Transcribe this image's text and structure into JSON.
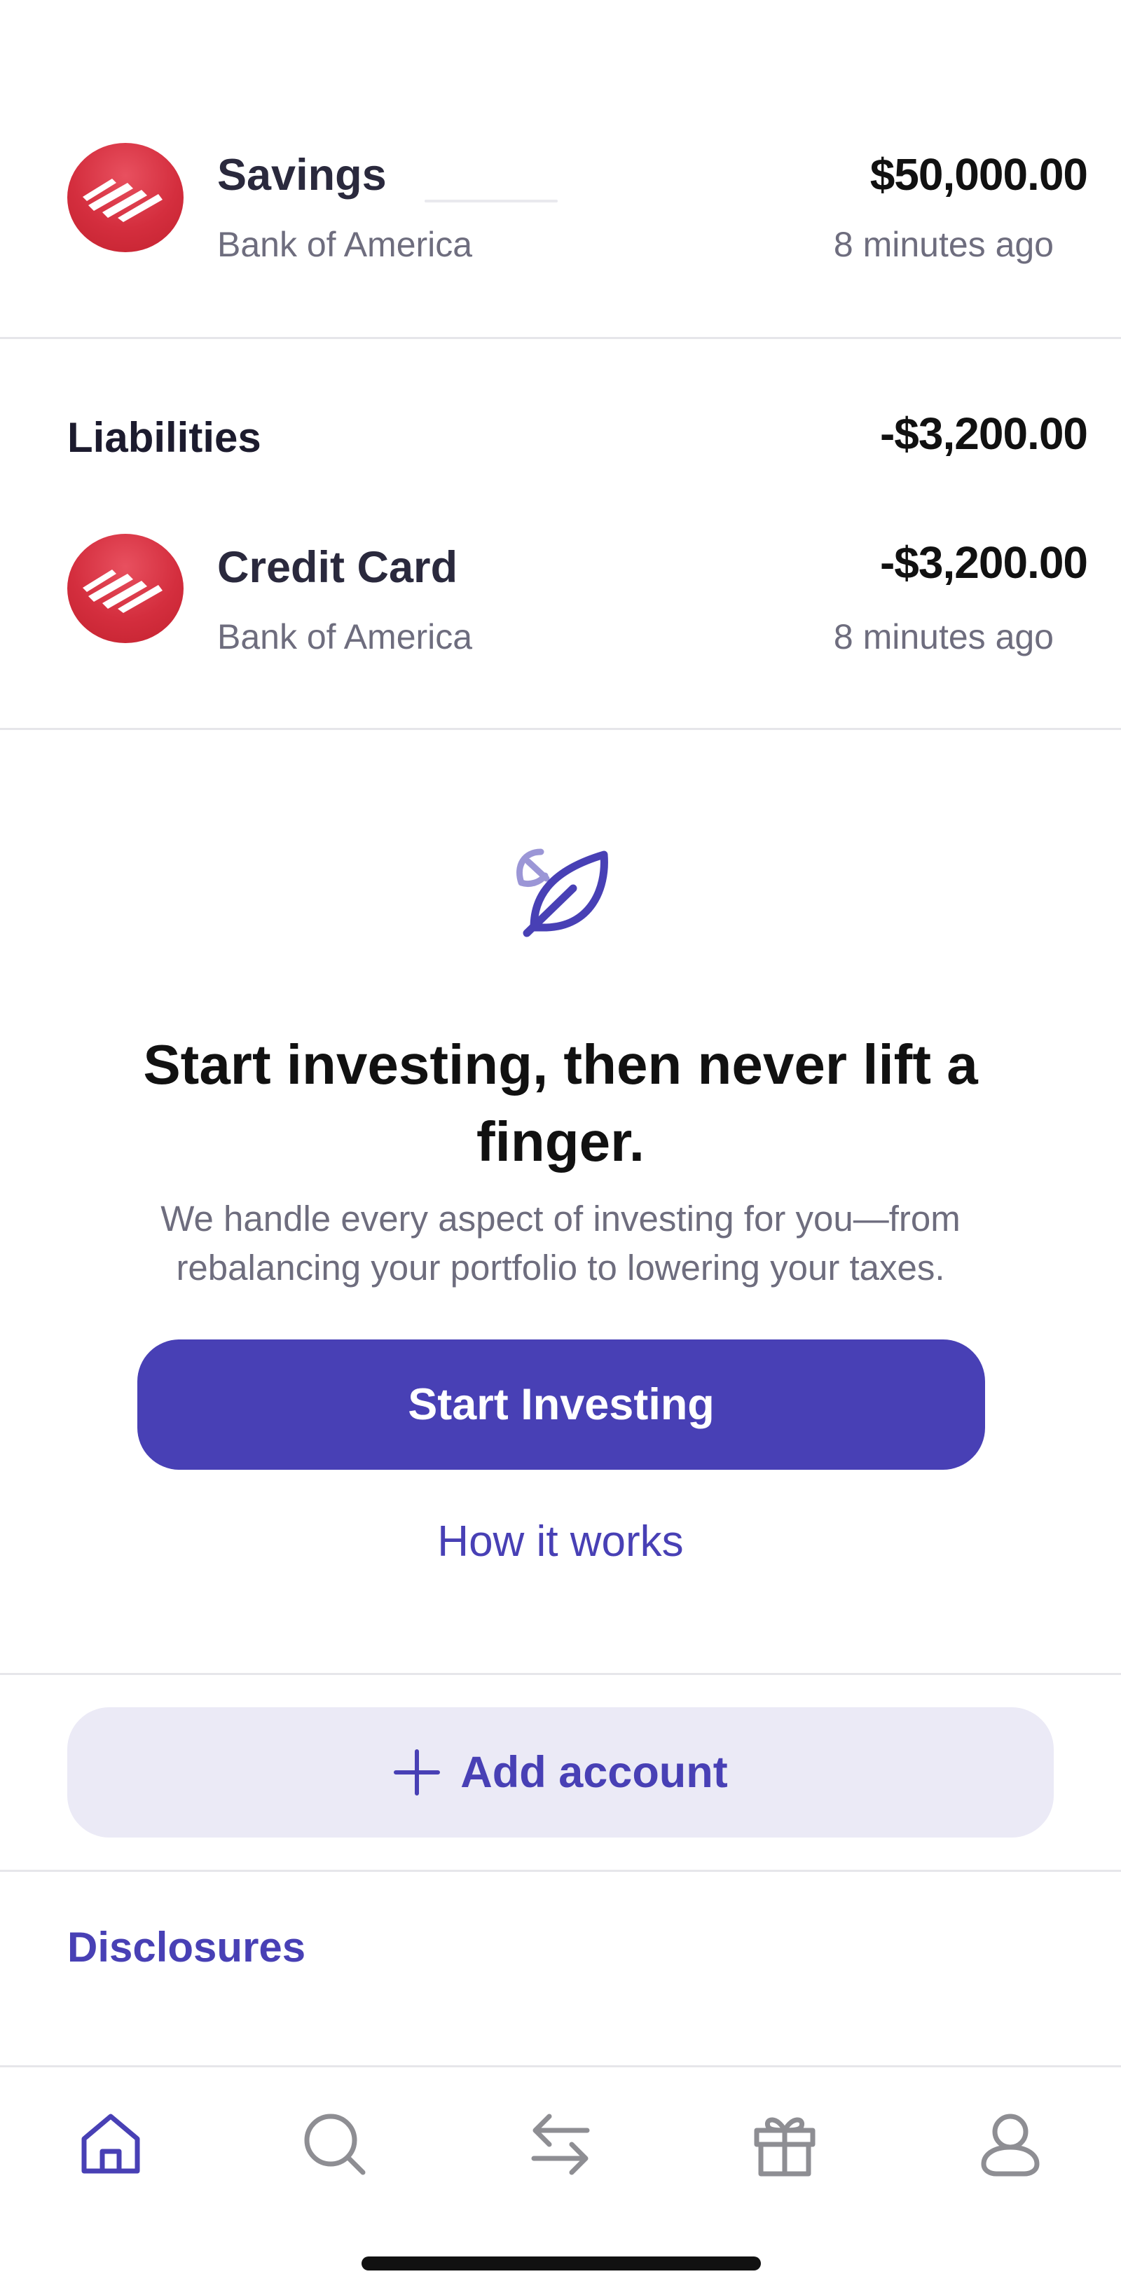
{
  "accounts": [
    {
      "name": "Savings",
      "institution": "Bank of America",
      "amount": "$50,000.00",
      "updated": "8 minutes ago",
      "logo_icon": "bank-of-america-logo"
    },
    {
      "name": "Credit Card",
      "institution": "Bank of America",
      "amount": "-$3,200.00",
      "updated": "8 minutes ago",
      "logo_icon": "bank-of-america-logo"
    }
  ],
  "liabilities": {
    "title": "Liabilities",
    "total": "-$3,200.00"
  },
  "promo": {
    "icon": "leaf-icon",
    "title": "Start investing, then never lift a finger.",
    "body": "We handle every aspect of investing for you—from rebalancing your portfolio to lowering your taxes.",
    "primary_button": "Start Investing",
    "secondary_link": "How it works"
  },
  "add_account": {
    "label": "Add account",
    "icon": "plus-icon"
  },
  "disclosures": "Disclosures",
  "tabbar": {
    "active": "home",
    "items": [
      "home-icon",
      "search-icon",
      "transfer-icon",
      "gift-icon",
      "profile-icon"
    ]
  },
  "colors": {
    "accent": "#4840b5",
    "accent_light": "#ebeaf6",
    "bank_red": "#d42e3e",
    "text_primary": "#1c1b2e",
    "text_secondary": "#6e6d7e",
    "tab_inactive": "#8e8e93"
  }
}
